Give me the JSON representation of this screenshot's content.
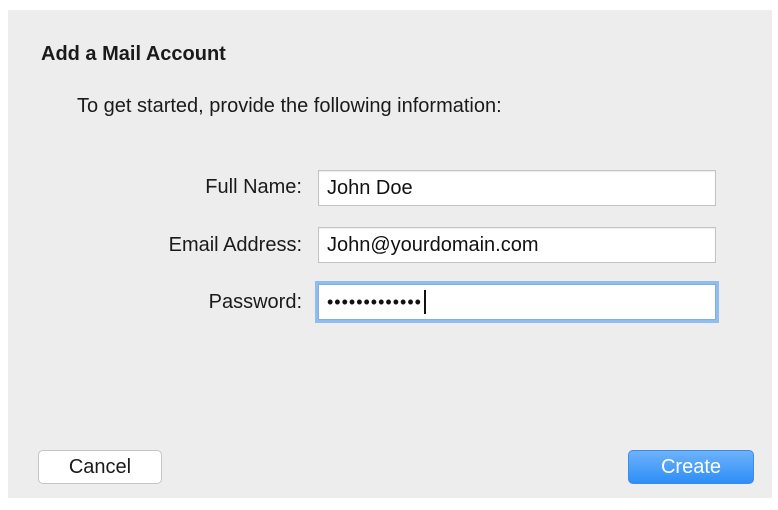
{
  "dialog": {
    "title": "Add a Mail Account",
    "intro": "To get started, provide the following information:"
  },
  "form": {
    "full_name": {
      "label": "Full Name:",
      "value": "John Doe"
    },
    "email": {
      "label": "Email Address:",
      "value": "John@yourdomain.com"
    },
    "password": {
      "label": "Password:",
      "masked_value": "•••••••••••••"
    }
  },
  "buttons": {
    "cancel_label": "Cancel",
    "create_label": "Create"
  },
  "colors": {
    "dialog_background": "#ededed",
    "accent": "#2e8ef7",
    "focus_ring": "#8fbdf0"
  }
}
